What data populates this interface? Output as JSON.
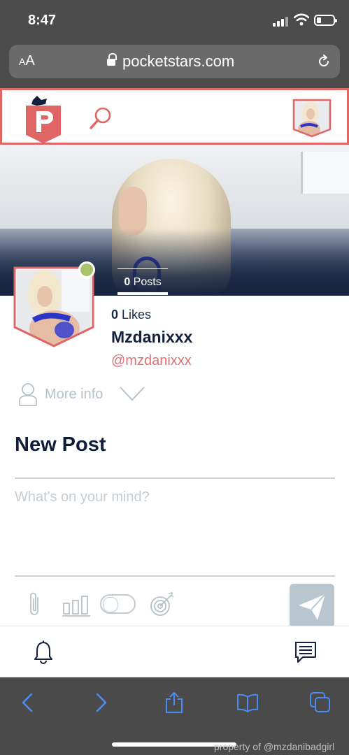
{
  "status_bar": {
    "time": "8:47"
  },
  "browser": {
    "aa_label_small": "A",
    "aa_label_big": "A",
    "url": "pocketstars.com"
  },
  "profile": {
    "posts_count": "0",
    "posts_label": "Posts",
    "likes_count": "0",
    "likes_label": "Likes",
    "display_name": "Mzdanixxx",
    "handle": "@mzdanixxx",
    "more_info_label": "More info",
    "online_color": "#a7c36b"
  },
  "composer": {
    "title": "New Post",
    "placeholder": "What's on your mind?"
  },
  "icons": {
    "logo": "pocketstars-logo",
    "search": "search-icon",
    "attach": "paperclip-icon",
    "poll": "poll-icon",
    "toggle": "toggle-icon",
    "target": "target-icon",
    "send": "send-icon",
    "bell": "bell-icon",
    "chat": "chat-icon"
  },
  "colors": {
    "brand": "#e06565",
    "navy": "#12213e",
    "safari_blue": "#4a8cf0"
  },
  "watermark": "property of @mzdanibadgirl"
}
